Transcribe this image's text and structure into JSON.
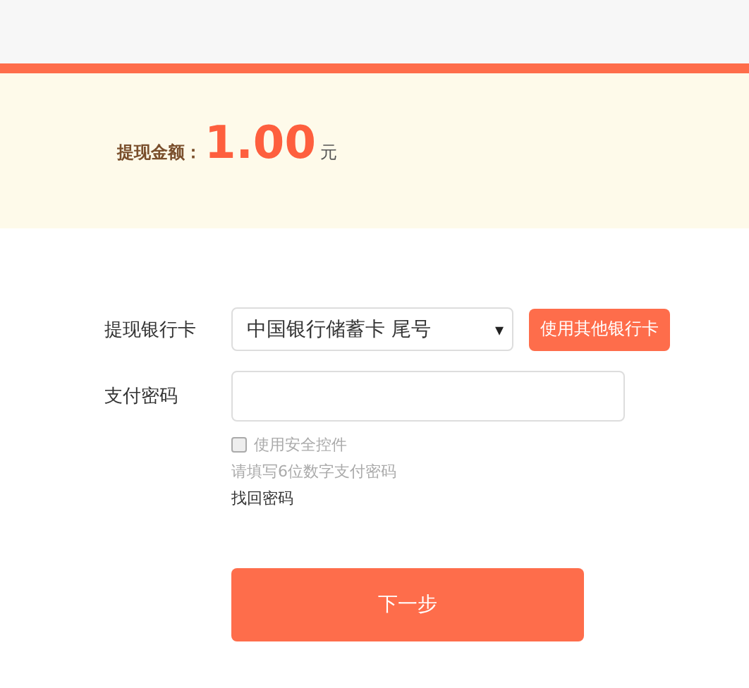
{
  "amount": {
    "label": "提现金额：",
    "value": "1.00",
    "unit": "元"
  },
  "form": {
    "card_label": "提现银行卡",
    "card_value": "中国银行储蓄卡 尾号",
    "card_caret": "▾",
    "other_card_button": "使用其他银行卡",
    "password_label": "支付密码",
    "security_control": {
      "label": "使用安全控件",
      "checked": false
    },
    "hint": "请填写6位数字支付密码",
    "recover_link": "找回密码"
  },
  "next_button": "下一步"
}
